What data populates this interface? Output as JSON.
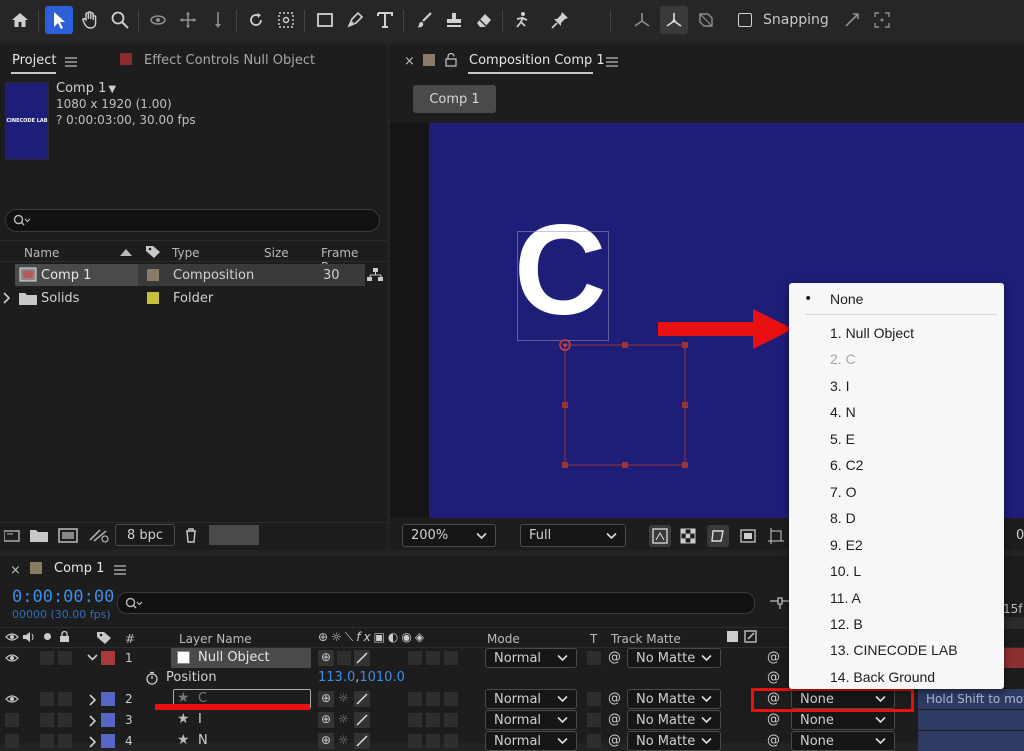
{
  "toolbar": {
    "snapping_label": "Snapping"
  },
  "project_panel": {
    "tab_project": "Project",
    "tab_effect_controls": "Effect Controls Null Object",
    "comp_name": "Comp 1",
    "comp_dims": "1080 x 1920 (1.00)",
    "comp_duration": "? 0:00:03:00, 30.00 fps",
    "thumb_text": "CINECODE LAB",
    "search_placeholder": "",
    "columns": {
      "name": "Name",
      "type": "Type",
      "size": "Size",
      "frame_rate": "Frame Ra..."
    },
    "items": [
      {
        "name": "Comp 1",
        "type": "Composition",
        "frame_rate": "30",
        "label_color": "#8a7a66"
      },
      {
        "name": "Solids",
        "type": "Folder",
        "frame_rate": "",
        "label_color": "#c6c03a"
      }
    ],
    "bpc": "8 bpc"
  },
  "comp_panel": {
    "tab_title": "Composition Comp 1",
    "breadcrumb": "Comp 1",
    "canvas_letter": "C",
    "canvas_color": "#1e1e78",
    "zoom": "200%",
    "resolution": "Full",
    "trailing_value": "0"
  },
  "timeline": {
    "tab_title": "Comp 1",
    "timecode": "0:00:00:00",
    "frames": "00000 (30.00 fps)",
    "ruler_label": "15f",
    "headers": {
      "num": "#",
      "layer_name": "Layer Name",
      "mode": "Mode",
      "t": "T",
      "track_matte": "Track Matte"
    },
    "layers": [
      {
        "num": "1",
        "name": "Null Object",
        "mode": "Normal",
        "matte": "No Matte",
        "parent": "",
        "color": "#a83a3a",
        "expanded": true
      },
      {
        "num": "2",
        "name": "C",
        "mode": "Normal",
        "matte": "No Matte",
        "parent": "None",
        "color": "#5566c4"
      },
      {
        "num": "3",
        "name": "I",
        "mode": "Normal",
        "matte": "No Matte",
        "parent": "None",
        "color": "#5566c4"
      },
      {
        "num": "4",
        "name": "N",
        "mode": "Normal",
        "matte": "No Matte",
        "parent": "None",
        "color": "#5566c4"
      }
    ],
    "position_label": "Position",
    "position_x": "113.0",
    "position_sep": ",",
    "position_y": "1010.0",
    "tooltip": "Hold Shift to mov"
  },
  "parent_menu": {
    "items": [
      {
        "label": "None",
        "checked": true,
        "disabled": false
      },
      {
        "label": "1. Null Object",
        "checked": false,
        "disabled": false
      },
      {
        "label": "2. C",
        "checked": false,
        "disabled": true
      },
      {
        "label": "3. I",
        "checked": false,
        "disabled": false
      },
      {
        "label": "4. N",
        "checked": false,
        "disabled": false
      },
      {
        "label": "5. E",
        "checked": false,
        "disabled": false
      },
      {
        "label": "6. C2",
        "checked": false,
        "disabled": false
      },
      {
        "label": "7. O",
        "checked": false,
        "disabled": false
      },
      {
        "label": "8. D",
        "checked": false,
        "disabled": false
      },
      {
        "label": "9. E2",
        "checked": false,
        "disabled": false
      },
      {
        "label": "10. L",
        "checked": false,
        "disabled": false
      },
      {
        "label": "11. A",
        "checked": false,
        "disabled": false
      },
      {
        "label": "12. B",
        "checked": false,
        "disabled": false
      },
      {
        "label": "13. CINECODE LAB",
        "checked": false,
        "disabled": false
      },
      {
        "label": "14. Back Ground",
        "checked": false,
        "disabled": false
      }
    ]
  },
  "colors": {
    "accent": "#2d5fd6",
    "annotation_red": "#e81010",
    "timecode_blue": "#3d8ee8"
  }
}
